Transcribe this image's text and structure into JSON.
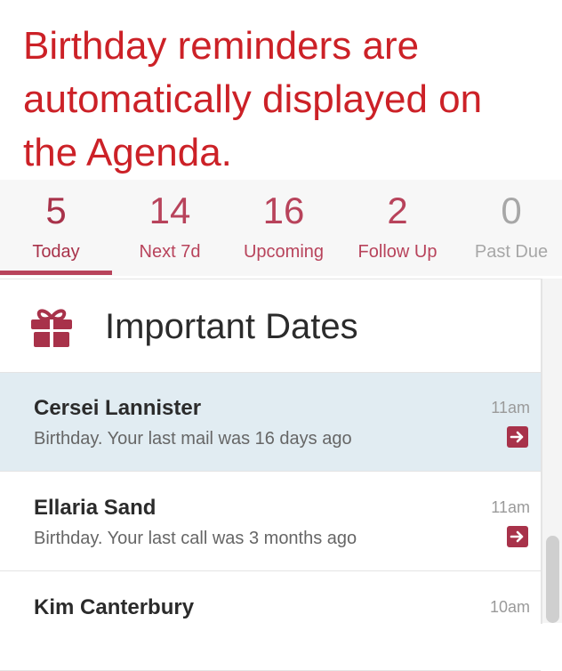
{
  "headline": "Birthday reminders are\nautomatically displayed on\nthe Agenda.",
  "tabs": [
    {
      "count": "5",
      "label": "Today"
    },
    {
      "count": "14",
      "label": "Next 7d"
    },
    {
      "count": "16",
      "label": "Upcoming"
    },
    {
      "count": "2",
      "label": "Follow Up"
    },
    {
      "count": "0",
      "label": "Past Due"
    }
  ],
  "active_tab": "Today",
  "section": {
    "title": "Important Dates",
    "icon": "gift-icon"
  },
  "items": [
    {
      "name": "Cersei Lannister",
      "desc": "Birthday. Your last mail was 16 days ago",
      "time": "11am",
      "selected": true
    },
    {
      "name": "Ellaria Sand",
      "desc": "Birthday. Your last call was 3 months ago",
      "time": "11am",
      "selected": false
    },
    {
      "name": "Kim Canterbury",
      "desc": "",
      "time": "10am",
      "selected": false
    }
  ],
  "colors": {
    "headline": "#cc2127",
    "accent": "#b8435b",
    "selected_row": "#e1ecf2"
  }
}
